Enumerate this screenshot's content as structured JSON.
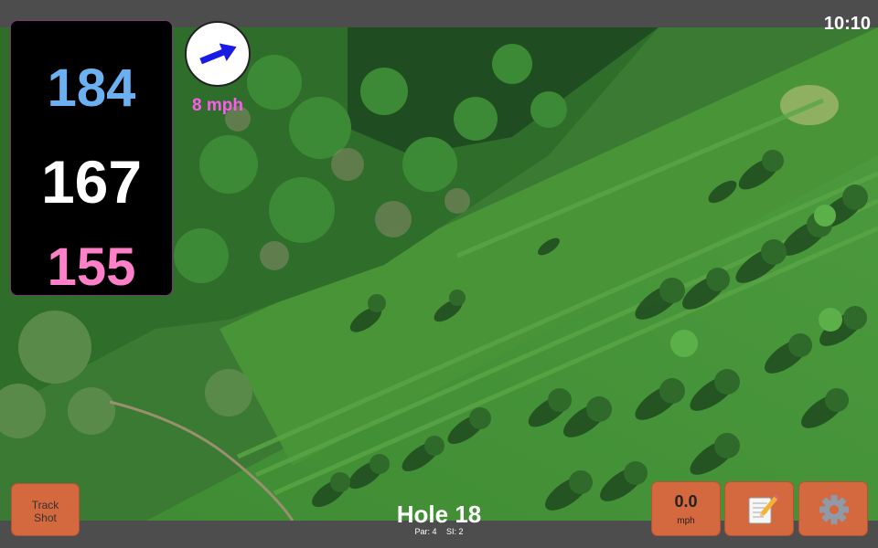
{
  "status": {
    "time": "10:10"
  },
  "distances": {
    "back": "184",
    "middle": "167",
    "front": "155"
  },
  "wind": {
    "speed_label": "8 mph",
    "icon": "wind-arrow-icon",
    "arrow_color": "#1a1ae6"
  },
  "hole": {
    "title": "Hole 18",
    "par": "Par: 4",
    "si": "SI: 2"
  },
  "buttons": {
    "track_line1": "Track",
    "track_line2": "Shot",
    "speed_value": "0.0",
    "speed_unit": "mph",
    "notes_icon": "notepad-icon",
    "settings_icon": "gear-icon"
  },
  "colors": {
    "button_bg": "#d4683e",
    "back_color": "#6bb0f0",
    "front_color": "#ff7fc8",
    "wind_text": "#ff5af0"
  }
}
